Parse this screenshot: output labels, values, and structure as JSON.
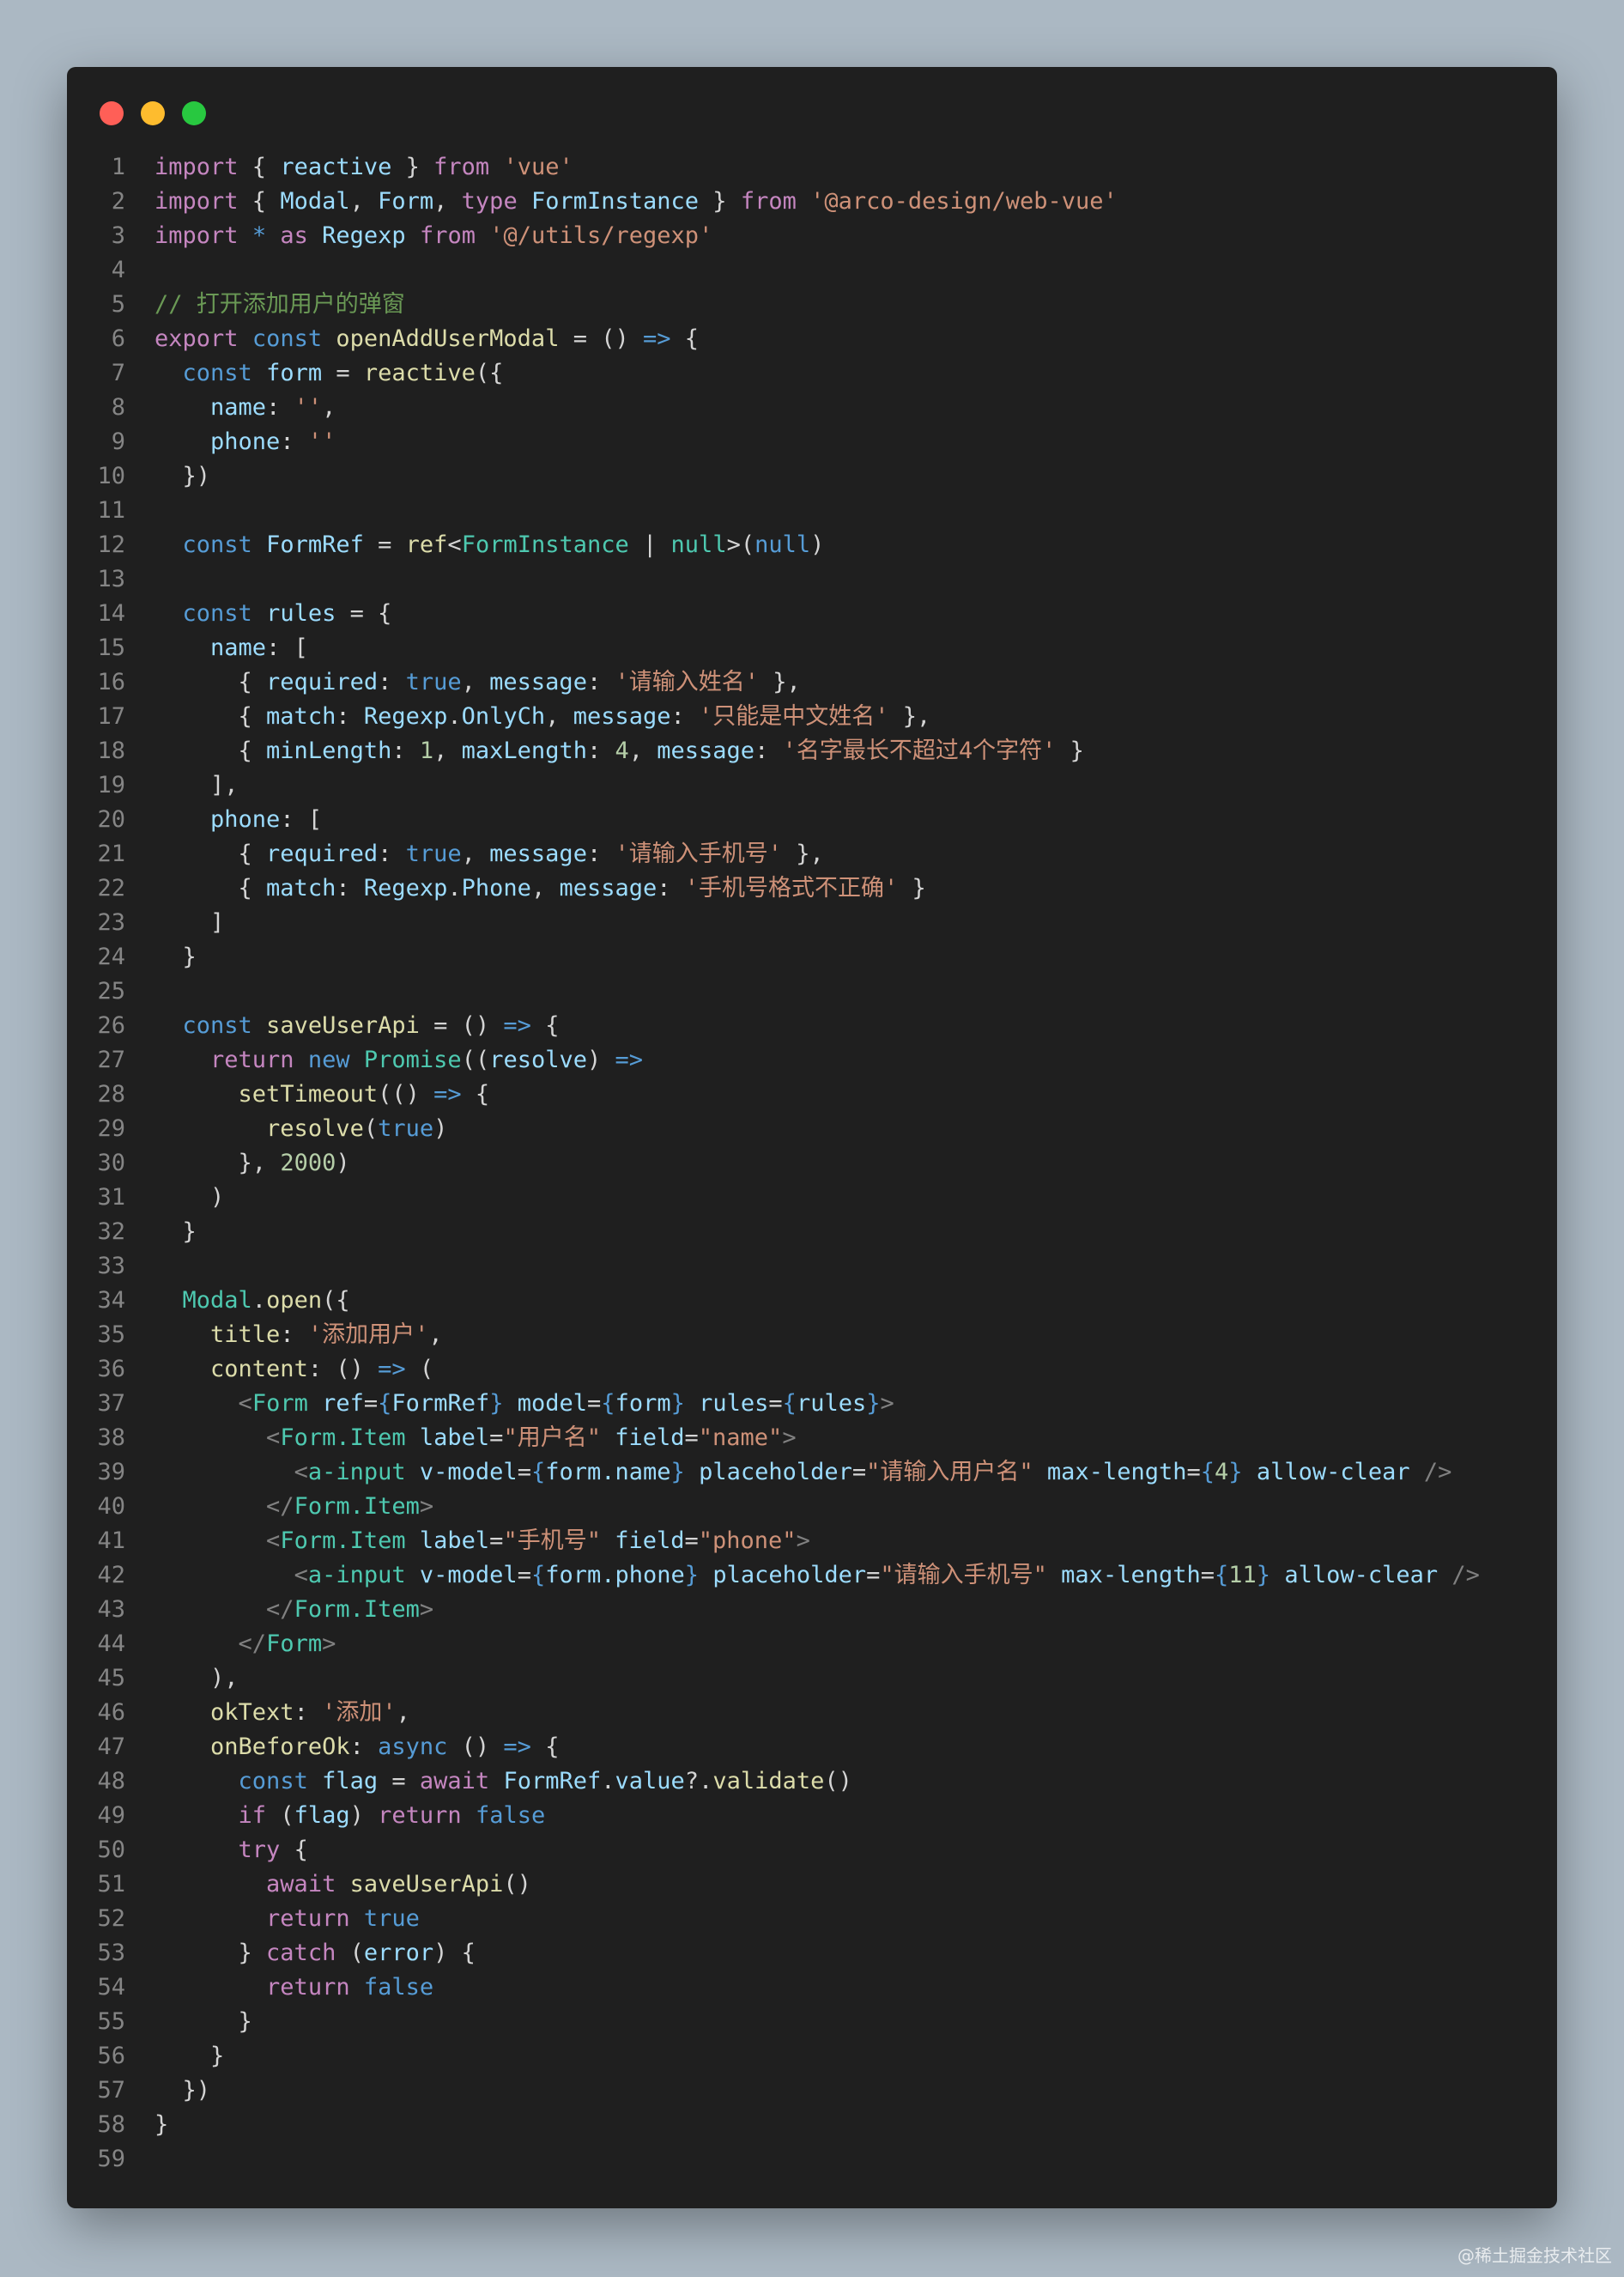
{
  "window": {
    "traffic_lights": [
      {
        "name": "close",
        "color": "#ff5f57"
      },
      {
        "name": "minimize",
        "color": "#febc2e"
      },
      {
        "name": "zoom",
        "color": "#28c840"
      }
    ]
  },
  "colors": {
    "k": "#c586c0",
    "s": "#569cd6",
    "v": "#9cdcfe",
    "f": "#dcdcaa",
    "t": "#4ec9b0",
    "str": "#ce9178",
    "n": "#b5cea8",
    "c": "#6a9955",
    "p": "#d4d4d4",
    "g": "#808080"
  },
  "code_lines": [
    [
      [
        "k",
        "import"
      ],
      [
        "p",
        " { "
      ],
      [
        "v",
        "reactive"
      ],
      [
        "p",
        " } "
      ],
      [
        "k",
        "from"
      ],
      [
        "p",
        " "
      ],
      [
        "str",
        "'vue'"
      ]
    ],
    [
      [
        "k",
        "import"
      ],
      [
        "p",
        " { "
      ],
      [
        "v",
        "Modal"
      ],
      [
        "p",
        ", "
      ],
      [
        "v",
        "Form"
      ],
      [
        "p",
        ", "
      ],
      [
        "k",
        "type"
      ],
      [
        "p",
        " "
      ],
      [
        "v",
        "FormInstance"
      ],
      [
        "p",
        " } "
      ],
      [
        "k",
        "from"
      ],
      [
        "p",
        " "
      ],
      [
        "str",
        "'@arco-design/web-vue'"
      ]
    ],
    [
      [
        "k",
        "import"
      ],
      [
        "p",
        " "
      ],
      [
        "s",
        "*"
      ],
      [
        "p",
        " "
      ],
      [
        "k",
        "as"
      ],
      [
        "p",
        " "
      ],
      [
        "v",
        "Regexp"
      ],
      [
        "p",
        " "
      ],
      [
        "k",
        "from"
      ],
      [
        "p",
        " "
      ],
      [
        "str",
        "'@/utils/regexp'"
      ]
    ],
    [],
    [
      [
        "c",
        "// 打开添加用户的弹窗"
      ]
    ],
    [
      [
        "k",
        "export"
      ],
      [
        "p",
        " "
      ],
      [
        "s",
        "const"
      ],
      [
        "p",
        " "
      ],
      [
        "f",
        "openAddUserModal"
      ],
      [
        "p",
        " = () "
      ],
      [
        "s",
        "=>"
      ],
      [
        "p",
        " {"
      ]
    ],
    [
      [
        "p",
        "  "
      ],
      [
        "s",
        "const"
      ],
      [
        "p",
        " "
      ],
      [
        "v",
        "form"
      ],
      [
        "p",
        " = "
      ],
      [
        "f",
        "reactive"
      ],
      [
        "p",
        "({"
      ]
    ],
    [
      [
        "p",
        "    "
      ],
      [
        "v",
        "name"
      ],
      [
        "p",
        ": "
      ],
      [
        "str",
        "''"
      ],
      [
        "p",
        ","
      ]
    ],
    [
      [
        "p",
        "    "
      ],
      [
        "v",
        "phone"
      ],
      [
        "p",
        ": "
      ],
      [
        "str",
        "''"
      ]
    ],
    [
      [
        "p",
        "  })"
      ]
    ],
    [],
    [
      [
        "p",
        "  "
      ],
      [
        "s",
        "const"
      ],
      [
        "p",
        " "
      ],
      [
        "v",
        "FormRef"
      ],
      [
        "p",
        " = "
      ],
      [
        "f",
        "ref"
      ],
      [
        "p",
        "<"
      ],
      [
        "t",
        "FormInstance"
      ],
      [
        "p",
        " | "
      ],
      [
        "t",
        "null"
      ],
      [
        "p",
        ">("
      ],
      [
        "s",
        "null"
      ],
      [
        "p",
        ")"
      ]
    ],
    [],
    [
      [
        "p",
        "  "
      ],
      [
        "s",
        "const"
      ],
      [
        "p",
        " "
      ],
      [
        "v",
        "rules"
      ],
      [
        "p",
        " = {"
      ]
    ],
    [
      [
        "p",
        "    "
      ],
      [
        "v",
        "name"
      ],
      [
        "p",
        ": ["
      ]
    ],
    [
      [
        "p",
        "      { "
      ],
      [
        "v",
        "required"
      ],
      [
        "p",
        ": "
      ],
      [
        "s",
        "true"
      ],
      [
        "p",
        ", "
      ],
      [
        "v",
        "message"
      ],
      [
        "p",
        ": "
      ],
      [
        "str",
        "'请输入姓名'"
      ],
      [
        "p",
        " },"
      ]
    ],
    [
      [
        "p",
        "      { "
      ],
      [
        "v",
        "match"
      ],
      [
        "p",
        ": "
      ],
      [
        "v",
        "Regexp"
      ],
      [
        "p",
        "."
      ],
      [
        "v",
        "OnlyCh"
      ],
      [
        "p",
        ", "
      ],
      [
        "v",
        "message"
      ],
      [
        "p",
        ": "
      ],
      [
        "str",
        "'只能是中文姓名'"
      ],
      [
        "p",
        " },"
      ]
    ],
    [
      [
        "p",
        "      { "
      ],
      [
        "v",
        "minLength"
      ],
      [
        "p",
        ": "
      ],
      [
        "n",
        "1"
      ],
      [
        "p",
        ", "
      ],
      [
        "v",
        "maxLength"
      ],
      [
        "p",
        ": "
      ],
      [
        "n",
        "4"
      ],
      [
        "p",
        ", "
      ],
      [
        "v",
        "message"
      ],
      [
        "p",
        ": "
      ],
      [
        "str",
        "'名字最长不超过4个字符'"
      ],
      [
        "p",
        " }"
      ]
    ],
    [
      [
        "p",
        "    ],"
      ]
    ],
    [
      [
        "p",
        "    "
      ],
      [
        "v",
        "phone"
      ],
      [
        "p",
        ": ["
      ]
    ],
    [
      [
        "p",
        "      { "
      ],
      [
        "v",
        "required"
      ],
      [
        "p",
        ": "
      ],
      [
        "s",
        "true"
      ],
      [
        "p",
        ", "
      ],
      [
        "v",
        "message"
      ],
      [
        "p",
        ": "
      ],
      [
        "str",
        "'请输入手机号'"
      ],
      [
        "p",
        " },"
      ]
    ],
    [
      [
        "p",
        "      { "
      ],
      [
        "v",
        "match"
      ],
      [
        "p",
        ": "
      ],
      [
        "v",
        "Regexp"
      ],
      [
        "p",
        "."
      ],
      [
        "v",
        "Phone"
      ],
      [
        "p",
        ", "
      ],
      [
        "v",
        "message"
      ],
      [
        "p",
        ": "
      ],
      [
        "str",
        "'手机号格式不正确'"
      ],
      [
        "p",
        " }"
      ]
    ],
    [
      [
        "p",
        "    ]"
      ]
    ],
    [
      [
        "p",
        "  }"
      ]
    ],
    [],
    [
      [
        "p",
        "  "
      ],
      [
        "s",
        "const"
      ],
      [
        "p",
        " "
      ],
      [
        "f",
        "saveUserApi"
      ],
      [
        "p",
        " = () "
      ],
      [
        "s",
        "=>"
      ],
      [
        "p",
        " {"
      ]
    ],
    [
      [
        "p",
        "    "
      ],
      [
        "k",
        "return"
      ],
      [
        "p",
        " "
      ],
      [
        "s",
        "new"
      ],
      [
        "p",
        " "
      ],
      [
        "t",
        "Promise"
      ],
      [
        "p",
        "(("
      ],
      [
        "v",
        "resolve"
      ],
      [
        "p",
        ") "
      ],
      [
        "s",
        "=>"
      ]
    ],
    [
      [
        "p",
        "      "
      ],
      [
        "f",
        "setTimeout"
      ],
      [
        "p",
        "(() "
      ],
      [
        "s",
        "=>"
      ],
      [
        "p",
        " {"
      ]
    ],
    [
      [
        "p",
        "        "
      ],
      [
        "f",
        "resolve"
      ],
      [
        "p",
        "("
      ],
      [
        "s",
        "true"
      ],
      [
        "p",
        ")"
      ]
    ],
    [
      [
        "p",
        "      }, "
      ],
      [
        "n",
        "2000"
      ],
      [
        "p",
        ")"
      ]
    ],
    [
      [
        "p",
        "    )"
      ]
    ],
    [
      [
        "p",
        "  }"
      ]
    ],
    [],
    [
      [
        "p",
        "  "
      ],
      [
        "t",
        "Modal"
      ],
      [
        "p",
        "."
      ],
      [
        "f",
        "open"
      ],
      [
        "p",
        "({"
      ]
    ],
    [
      [
        "p",
        "    "
      ],
      [
        "f",
        "title"
      ],
      [
        "p",
        ": "
      ],
      [
        "str",
        "'添加用户'"
      ],
      [
        "p",
        ","
      ]
    ],
    [
      [
        "p",
        "    "
      ],
      [
        "f",
        "content"
      ],
      [
        "p",
        ": () "
      ],
      [
        "s",
        "=>"
      ],
      [
        "p",
        " ("
      ]
    ],
    [
      [
        "p",
        "      "
      ],
      [
        "g",
        "<"
      ],
      [
        "t",
        "Form"
      ],
      [
        "p",
        " "
      ],
      [
        "v",
        "ref"
      ],
      [
        "p",
        "="
      ],
      [
        "s",
        "{"
      ],
      [
        "v",
        "FormRef"
      ],
      [
        "s",
        "}"
      ],
      [
        "p",
        " "
      ],
      [
        "v",
        "model"
      ],
      [
        "p",
        "="
      ],
      [
        "s",
        "{"
      ],
      [
        "v",
        "form"
      ],
      [
        "s",
        "}"
      ],
      [
        "p",
        " "
      ],
      [
        "v",
        "rules"
      ],
      [
        "p",
        "="
      ],
      [
        "s",
        "{"
      ],
      [
        "v",
        "rules"
      ],
      [
        "s",
        "}"
      ],
      [
        "g",
        ">"
      ]
    ],
    [
      [
        "p",
        "        "
      ],
      [
        "g",
        "<"
      ],
      [
        "t",
        "Form.Item"
      ],
      [
        "p",
        " "
      ],
      [
        "v",
        "label"
      ],
      [
        "p",
        "="
      ],
      [
        "str",
        "\"用户名\""
      ],
      [
        "p",
        " "
      ],
      [
        "v",
        "field"
      ],
      [
        "p",
        "="
      ],
      [
        "str",
        "\"name\""
      ],
      [
        "g",
        ">"
      ]
    ],
    [
      [
        "p",
        "          "
      ],
      [
        "g",
        "<"
      ],
      [
        "t",
        "a-input"
      ],
      [
        "p",
        " "
      ],
      [
        "v",
        "v-model"
      ],
      [
        "p",
        "="
      ],
      [
        "s",
        "{"
      ],
      [
        "v",
        "form.name"
      ],
      [
        "s",
        "}"
      ],
      [
        "p",
        " "
      ],
      [
        "v",
        "placeholder"
      ],
      [
        "p",
        "="
      ],
      [
        "str",
        "\"请输入用户名\""
      ],
      [
        "p",
        " "
      ],
      [
        "v",
        "max-length"
      ],
      [
        "p",
        "="
      ],
      [
        "s",
        "{"
      ],
      [
        "n",
        "4"
      ],
      [
        "s",
        "}"
      ],
      [
        "p",
        " "
      ],
      [
        "v",
        "allow-clear"
      ],
      [
        "p",
        " "
      ],
      [
        "g",
        "/>"
      ]
    ],
    [
      [
        "p",
        "        "
      ],
      [
        "g",
        "</"
      ],
      [
        "t",
        "Form.Item"
      ],
      [
        "g",
        ">"
      ]
    ],
    [
      [
        "p",
        "        "
      ],
      [
        "g",
        "<"
      ],
      [
        "t",
        "Form.Item"
      ],
      [
        "p",
        " "
      ],
      [
        "v",
        "label"
      ],
      [
        "p",
        "="
      ],
      [
        "str",
        "\"手机号\""
      ],
      [
        "p",
        " "
      ],
      [
        "v",
        "field"
      ],
      [
        "p",
        "="
      ],
      [
        "str",
        "\"phone\""
      ],
      [
        "g",
        ">"
      ]
    ],
    [
      [
        "p",
        "          "
      ],
      [
        "g",
        "<"
      ],
      [
        "t",
        "a-input"
      ],
      [
        "p",
        " "
      ],
      [
        "v",
        "v-model"
      ],
      [
        "p",
        "="
      ],
      [
        "s",
        "{"
      ],
      [
        "v",
        "form.phone"
      ],
      [
        "s",
        "}"
      ],
      [
        "p",
        " "
      ],
      [
        "v",
        "placeholder"
      ],
      [
        "p",
        "="
      ],
      [
        "str",
        "\"请输入手机号\""
      ],
      [
        "p",
        " "
      ],
      [
        "v",
        "max-length"
      ],
      [
        "p",
        "="
      ],
      [
        "s",
        "{"
      ],
      [
        "n",
        "11"
      ],
      [
        "s",
        "}"
      ],
      [
        "p",
        " "
      ],
      [
        "v",
        "allow-clear"
      ],
      [
        "p",
        " "
      ],
      [
        "g",
        "/>"
      ]
    ],
    [
      [
        "p",
        "        "
      ],
      [
        "g",
        "</"
      ],
      [
        "t",
        "Form.Item"
      ],
      [
        "g",
        ">"
      ]
    ],
    [
      [
        "p",
        "      "
      ],
      [
        "g",
        "</"
      ],
      [
        "t",
        "Form"
      ],
      [
        "g",
        ">"
      ]
    ],
    [
      [
        "p",
        "    ),"
      ]
    ],
    [
      [
        "p",
        "    "
      ],
      [
        "f",
        "okText"
      ],
      [
        "p",
        ": "
      ],
      [
        "str",
        "'添加'"
      ],
      [
        "p",
        ","
      ]
    ],
    [
      [
        "p",
        "    "
      ],
      [
        "f",
        "onBeforeOk"
      ],
      [
        "p",
        ": "
      ],
      [
        "s",
        "async"
      ],
      [
        "p",
        " () "
      ],
      [
        "s",
        "=>"
      ],
      [
        "p",
        " {"
      ]
    ],
    [
      [
        "p",
        "      "
      ],
      [
        "s",
        "const"
      ],
      [
        "p",
        " "
      ],
      [
        "v",
        "flag"
      ],
      [
        "p",
        " = "
      ],
      [
        "k",
        "await"
      ],
      [
        "p",
        " "
      ],
      [
        "v",
        "FormRef"
      ],
      [
        "p",
        "."
      ],
      [
        "v",
        "value"
      ],
      [
        "p",
        "?."
      ],
      [
        "f",
        "validate"
      ],
      [
        "p",
        "()"
      ]
    ],
    [
      [
        "p",
        "      "
      ],
      [
        "k",
        "if"
      ],
      [
        "p",
        " ("
      ],
      [
        "v",
        "flag"
      ],
      [
        "p",
        ") "
      ],
      [
        "k",
        "return"
      ],
      [
        "p",
        " "
      ],
      [
        "s",
        "false"
      ]
    ],
    [
      [
        "p",
        "      "
      ],
      [
        "k",
        "try"
      ],
      [
        "p",
        " {"
      ]
    ],
    [
      [
        "p",
        "        "
      ],
      [
        "k",
        "await"
      ],
      [
        "p",
        " "
      ],
      [
        "f",
        "saveUserApi"
      ],
      [
        "p",
        "()"
      ]
    ],
    [
      [
        "p",
        "        "
      ],
      [
        "k",
        "return"
      ],
      [
        "p",
        " "
      ],
      [
        "s",
        "true"
      ]
    ],
    [
      [
        "p",
        "      } "
      ],
      [
        "k",
        "catch"
      ],
      [
        "p",
        " ("
      ],
      [
        "v",
        "error"
      ],
      [
        "p",
        ") {"
      ]
    ],
    [
      [
        "p",
        "        "
      ],
      [
        "k",
        "return"
      ],
      [
        "p",
        " "
      ],
      [
        "s",
        "false"
      ]
    ],
    [
      [
        "p",
        "      }"
      ]
    ],
    [
      [
        "p",
        "    }"
      ]
    ],
    [
      [
        "p",
        "  })"
      ]
    ],
    [
      [
        "p",
        "}"
      ]
    ],
    []
  ],
  "watermark": "@稀土掘金技术社区"
}
